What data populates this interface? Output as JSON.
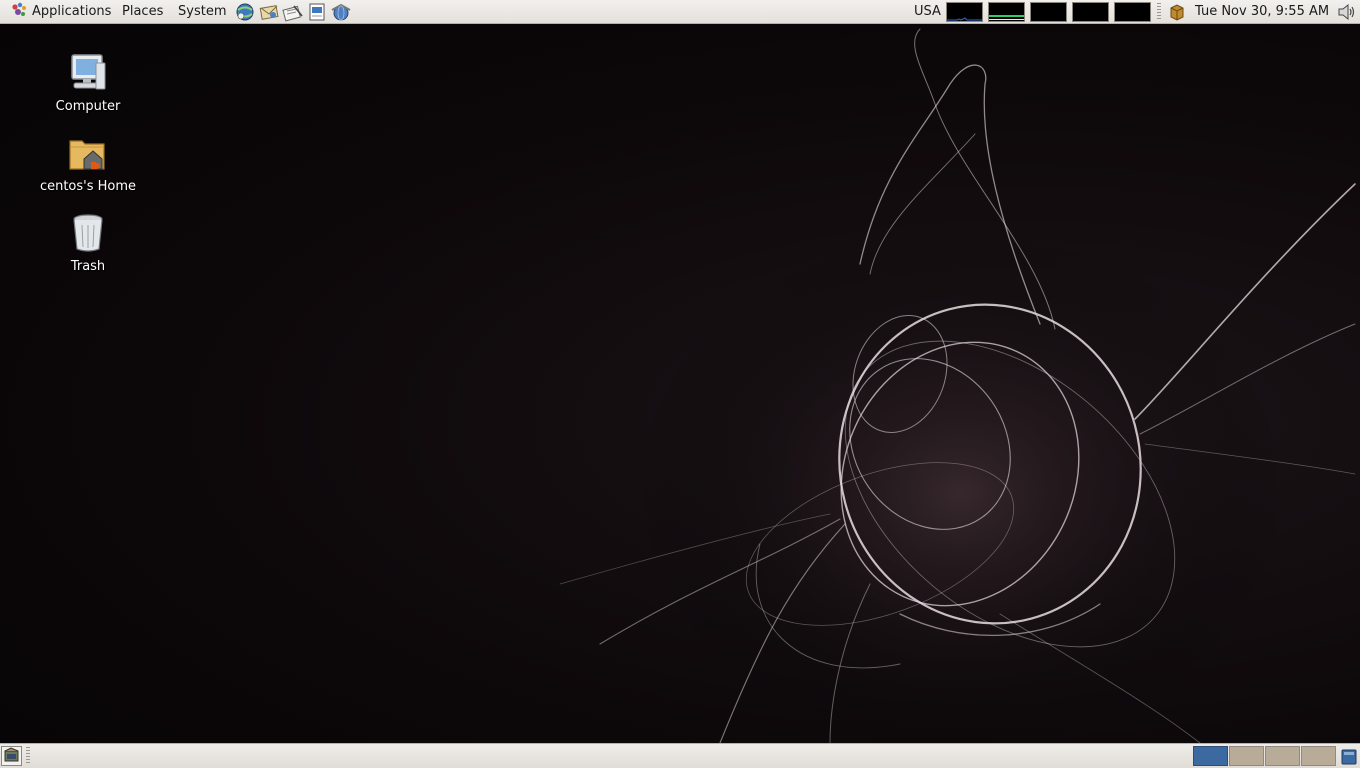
{
  "top_panel": {
    "menus": {
      "applications": "Applications",
      "places": "Places",
      "system": "System"
    },
    "launchers": [
      "web-browser-icon",
      "email-client-icon",
      "text-editor-icon",
      "document-viewer-icon",
      "network-icon"
    ],
    "keyboard_layout": "USA",
    "clock": "Tue Nov 30,  9:55 AM"
  },
  "desktop": {
    "icons": [
      {
        "label": "Computer",
        "icon": "computer-icon"
      },
      {
        "label": "centos's Home",
        "icon": "home-folder-icon"
      },
      {
        "label": "Trash",
        "icon": "trash-icon"
      }
    ]
  },
  "bottom_panel": {
    "workspaces": 4,
    "active_workspace": 1
  },
  "colors": {
    "panel_bg": "#e8e5e0",
    "desktop_bg": "#0d080a",
    "workspace_active": "#3c6aa0",
    "workspace_inactive": "#b8ab98",
    "monitor_green": "#2ecc71"
  }
}
